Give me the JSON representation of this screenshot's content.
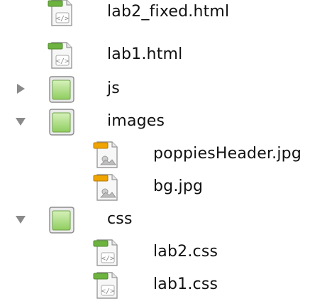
{
  "tree": {
    "items": [
      {
        "name": "lab2_fixed.html",
        "kind": "html"
      },
      {
        "name": "lab1.html",
        "kind": "html"
      },
      {
        "name": "js",
        "kind": "folder",
        "expanded": false
      },
      {
        "name": "images",
        "kind": "folder",
        "expanded": true
      },
      {
        "name": "poppiesHeader.jpg",
        "kind": "image"
      },
      {
        "name": "bg.jpg",
        "kind": "image"
      },
      {
        "name": "css",
        "kind": "folder",
        "expanded": true
      },
      {
        "name": "lab2.css",
        "kind": "css"
      },
      {
        "name": "lab1.css",
        "kind": "css"
      }
    ]
  },
  "colors": {
    "html_tab": "#6db33f",
    "css_tab": "#6db33f",
    "image_tab": "#f0a400",
    "folder_green": "#a9dc7c",
    "disclosure_arrow": "#8a8a8a"
  }
}
